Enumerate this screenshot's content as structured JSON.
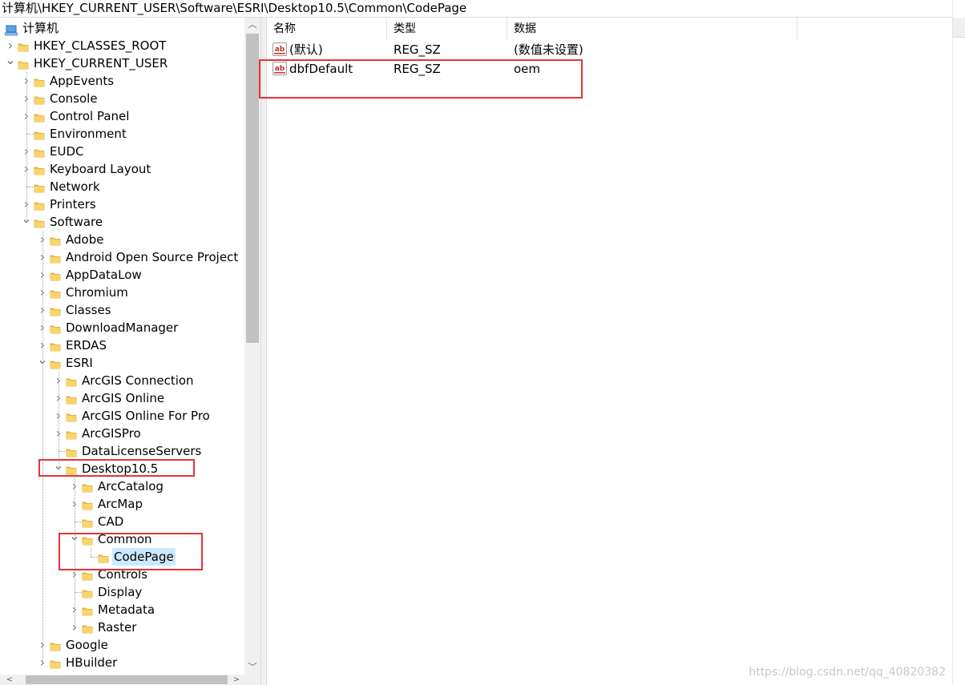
{
  "address_path": "计算机\\HKEY_CURRENT_USER\\Software\\ESRI\\Desktop10.5\\Common\\CodePage",
  "tree": [
    {
      "label": "计算机",
      "level": 0,
      "state": "root"
    },
    {
      "label": "HKEY_CLASSES_ROOT",
      "level": 1,
      "state": "collapsed"
    },
    {
      "label": "HKEY_CURRENT_USER",
      "level": 1,
      "state": "expanded"
    },
    {
      "label": "AppEvents",
      "level": 2,
      "state": "collapsed"
    },
    {
      "label": "Console",
      "level": 2,
      "state": "collapsed"
    },
    {
      "label": "Control Panel",
      "level": 2,
      "state": "collapsed"
    },
    {
      "label": "Environment",
      "level": 2,
      "state": "leaf"
    },
    {
      "label": "EUDC",
      "level": 2,
      "state": "collapsed"
    },
    {
      "label": "Keyboard Layout",
      "level": 2,
      "state": "collapsed"
    },
    {
      "label": "Network",
      "level": 2,
      "state": "leaf"
    },
    {
      "label": "Printers",
      "level": 2,
      "state": "collapsed"
    },
    {
      "label": "Software",
      "level": 2,
      "state": "expanded"
    },
    {
      "label": "Adobe",
      "level": 3,
      "state": "collapsed"
    },
    {
      "label": "Android Open Source Project",
      "level": 3,
      "state": "collapsed"
    },
    {
      "label": "AppDataLow",
      "level": 3,
      "state": "collapsed"
    },
    {
      "label": "Chromium",
      "level": 3,
      "state": "collapsed"
    },
    {
      "label": "Classes",
      "level": 3,
      "state": "collapsed"
    },
    {
      "label": "DownloadManager",
      "level": 3,
      "state": "collapsed"
    },
    {
      "label": "ERDAS",
      "level": 3,
      "state": "collapsed"
    },
    {
      "label": "ESRI",
      "level": 3,
      "state": "expanded"
    },
    {
      "label": "ArcGIS Connection",
      "level": 4,
      "state": "collapsed"
    },
    {
      "label": "ArcGIS Online",
      "level": 4,
      "state": "collapsed"
    },
    {
      "label": "ArcGIS Online For Pro",
      "level": 4,
      "state": "collapsed"
    },
    {
      "label": "ArcGISPro",
      "level": 4,
      "state": "collapsed"
    },
    {
      "label": "DataLicenseServers",
      "level": 4,
      "state": "leaf"
    },
    {
      "label": "Desktop10.5",
      "level": 4,
      "state": "expanded"
    },
    {
      "label": "ArcCatalog",
      "level": 5,
      "state": "collapsed"
    },
    {
      "label": "ArcMap",
      "level": 5,
      "state": "collapsed"
    },
    {
      "label": "CAD",
      "level": 5,
      "state": "leaf"
    },
    {
      "label": "Common",
      "level": 5,
      "state": "expanded"
    },
    {
      "label": "CodePage",
      "level": 6,
      "state": "leaf",
      "selected": true
    },
    {
      "label": "Controls",
      "level": 5,
      "state": "collapsed"
    },
    {
      "label": "Display",
      "level": 5,
      "state": "leaf"
    },
    {
      "label": "Metadata",
      "level": 5,
      "state": "collapsed"
    },
    {
      "label": "Raster",
      "level": 5,
      "state": "collapsed"
    },
    {
      "label": "Google",
      "level": 3,
      "state": "collapsed"
    },
    {
      "label": "HBuilder",
      "level": 3,
      "state": "collapsed"
    }
  ],
  "columns": {
    "name": "名称",
    "type": "类型",
    "data": "数据"
  },
  "values": [
    {
      "name": "(默认)",
      "type": "REG_SZ",
      "data": "(数值未设置)"
    },
    {
      "name": "dbfDefault",
      "type": "REG_SZ",
      "data": "oem"
    }
  ],
  "watermark": "https://blog.csdn.net/qq_40820382",
  "colors": {
    "selection": "#cce8ff",
    "highlight_box": "#e5333a",
    "folder": "#f3c44a",
    "string_icon": "#c9302c"
  }
}
